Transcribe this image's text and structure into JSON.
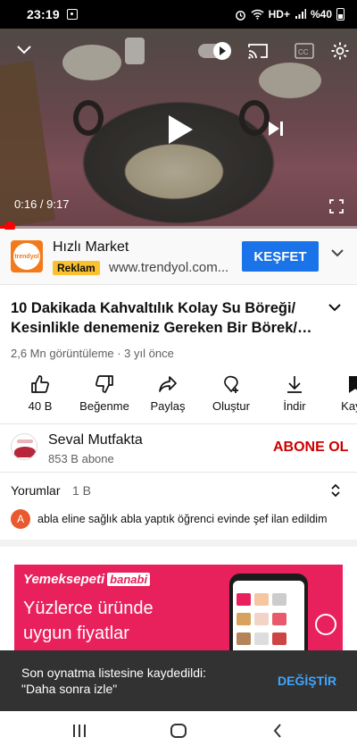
{
  "status_bar": {
    "time": "23:19",
    "network": "HD+",
    "battery": "%40"
  },
  "player": {
    "current_time": "0:16",
    "duration": "9:17",
    "time_separator": " / ",
    "progress_fraction": 0.0287
  },
  "ad": {
    "logo_text": "trendyol",
    "title": "Hızlı Market",
    "badge": "Reklam",
    "url": "www.trendyol.com...",
    "cta": "KEŞFET"
  },
  "video": {
    "title_line1": "10 Dakikada Kahvaltılık Kolay Su Böreği/",
    "title_line2": "Kesinlikle denemeniz Gereken Bir Börek/S...",
    "meta": "2,6 Mn görüntüleme · 3 yıl önce"
  },
  "actions": [
    {
      "label": "40 B",
      "icon": "thumbs-up-icon"
    },
    {
      "label": "Beğenme",
      "icon": "thumbs-down-icon"
    },
    {
      "label": "Paylaş",
      "icon": "share-icon"
    },
    {
      "label": "Oluştur",
      "icon": "create-icon"
    },
    {
      "label": "İndir",
      "icon": "download-icon"
    },
    {
      "label": "Kayd",
      "icon": "save-icon"
    }
  ],
  "channel": {
    "name": "Seval Mutfakta",
    "subscribers": "853 B abone",
    "subscribe_label": "ABONE OL"
  },
  "comments": {
    "heading": "Yorumlar",
    "count": "1 B",
    "first_avatar_letter": "A",
    "first_comment": "abla eline sağlık abla yaptık öğrenci evinde şef ilan edildim"
  },
  "banner": {
    "brand": "Yemeksepeti",
    "brand_tag": "banabi",
    "line1": "Yüzlerce üründe",
    "line2": "uygun fiyatlar"
  },
  "snackbar": {
    "line1": "Son oynatma listesine kaydedildi:",
    "line2": "\"Daha sonra izle\"",
    "action": "DEĞİŞTİR"
  },
  "colors": {
    "accent_red": "#ff0000",
    "subscribe_red": "#cc0000",
    "cta_blue": "#1a73e8",
    "snack_action": "#3ea6ff"
  }
}
